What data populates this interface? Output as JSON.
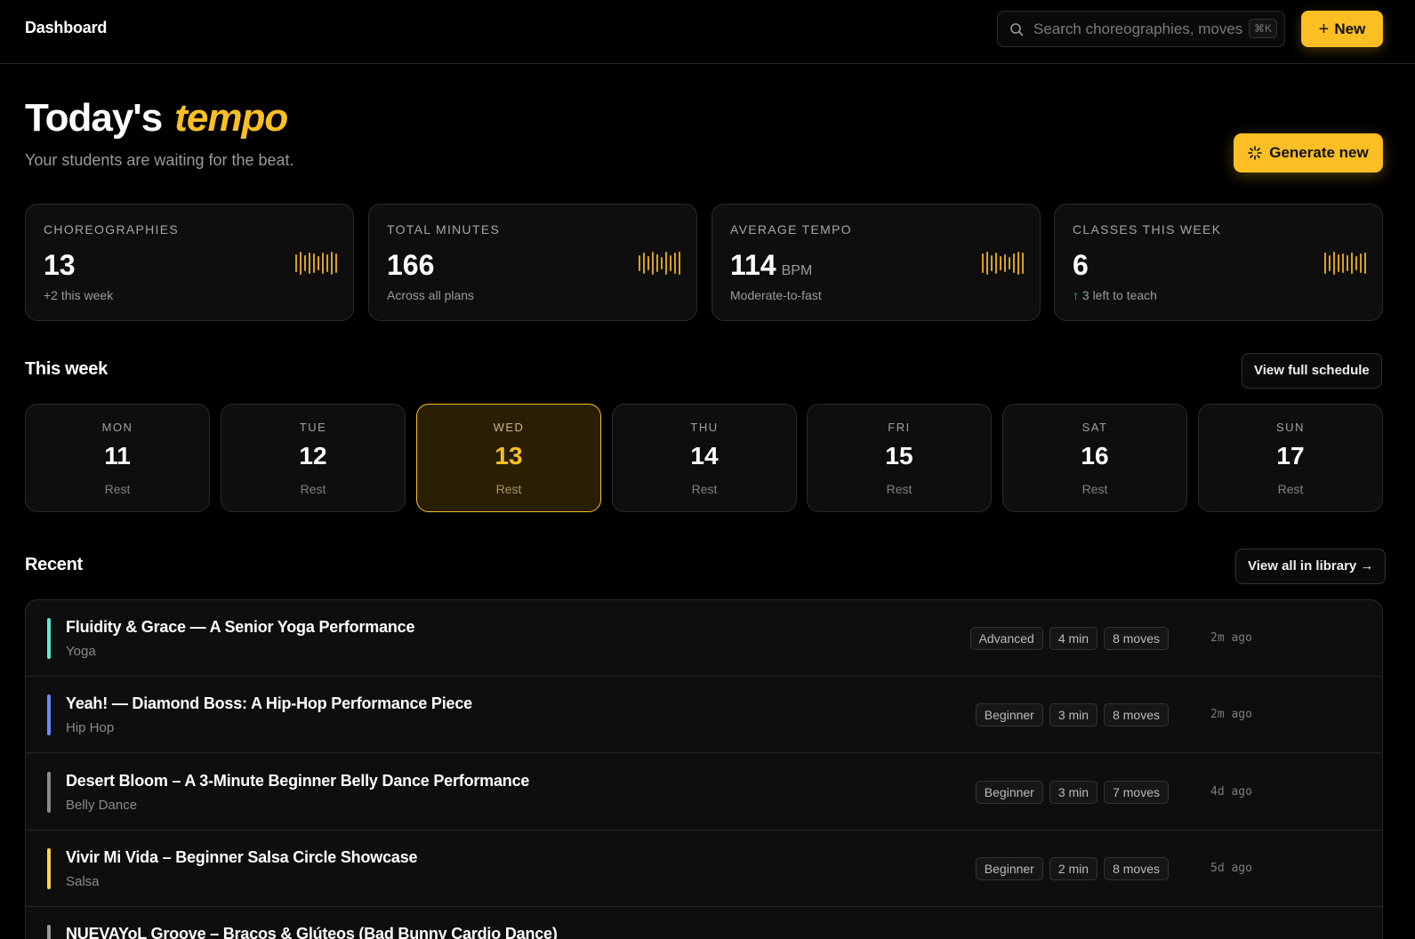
{
  "header": {
    "title": "Dashboard",
    "search_placeholder": "Search choreographies, moves",
    "search_shortcut": "⌘K",
    "new_label": "New"
  },
  "hero": {
    "title_main": "Today's",
    "title_accent": "tempo",
    "subtitle": "Your students are waiting for the beat.",
    "generate_label": "Generate new"
  },
  "stats": [
    {
      "label": "CHOREOGRAPHIES",
      "value": "13",
      "unit": "",
      "note": "+2 this week",
      "note_arrow": ""
    },
    {
      "label": "TOTAL MINUTES",
      "value": "166",
      "unit": "",
      "note": "Across all plans",
      "note_arrow": ""
    },
    {
      "label": "AVERAGE TEMPO",
      "value": "114",
      "unit": "BPM",
      "note": "Moderate-to-fast",
      "note_arrow": ""
    },
    {
      "label": "CLASSES THIS WEEK",
      "value": "6",
      "unit": "",
      "note": "3 left to teach",
      "note_arrow": "↑"
    }
  ],
  "week": {
    "title": "This week",
    "action_label": "View full schedule",
    "days": [
      {
        "name": "MON",
        "num": "11",
        "status": "Rest"
      },
      {
        "name": "TUE",
        "num": "12",
        "status": "Rest"
      },
      {
        "name": "WED",
        "num": "13",
        "status": "Rest"
      },
      {
        "name": "THU",
        "num": "14",
        "status": "Rest"
      },
      {
        "name": "FRI",
        "num": "15",
        "status": "Rest"
      },
      {
        "name": "SAT",
        "num": "16",
        "status": "Rest"
      },
      {
        "name": "SUN",
        "num": "17",
        "status": "Rest"
      }
    ]
  },
  "recent": {
    "title": "Recent",
    "action_label": "View all in library →",
    "items": [
      {
        "title": "Fluidity & Grace — A Senior Yoga Performance",
        "category": "Yoga",
        "level": "Advanced",
        "duration": "4 min",
        "moves": "8 moves",
        "time": "2m ago",
        "color": "#5eead4"
      },
      {
        "title": "Yeah! — Diamond Boss: A Hip-Hop Performance Piece",
        "category": "Hip Hop",
        "level": "Beginner",
        "duration": "3 min",
        "moves": "8 moves",
        "time": "2m ago",
        "color": "#6b8cff"
      },
      {
        "title": "Desert Bloom – A 3-Minute Beginner Belly Dance Performance",
        "category": "Belly Dance",
        "level": "Beginner",
        "duration": "3 min",
        "moves": "7 moves",
        "time": "4d ago",
        "color": "#8a8a8a"
      },
      {
        "title": "Vivir Mi Vida – Beginner Salsa Circle Showcase",
        "category": "Salsa",
        "level": "Beginner",
        "duration": "2 min",
        "moves": "8 moves",
        "time": "5d ago",
        "color": "#fcd34d"
      },
      {
        "title": "NUEVAYoL Groove – Bracos & Glúteos (Bad Bunny Cardio Dance)",
        "category": "",
        "level": "",
        "duration": "",
        "moves": "",
        "time": "",
        "color": "#9a9a9a"
      }
    ]
  },
  "colors": {
    "accent": "#fbbf24",
    "background": "#000000",
    "card": "#0e0e0e",
    "positive": "#22c55e"
  }
}
